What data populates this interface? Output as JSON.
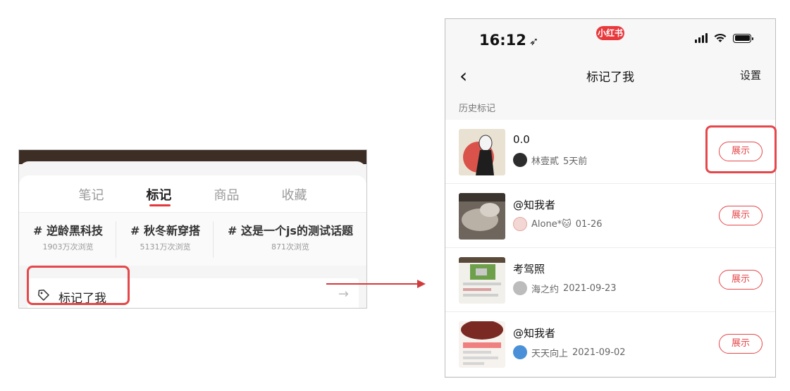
{
  "left": {
    "tabs": [
      "笔记",
      "标记",
      "商品",
      "收藏"
    ],
    "active_tab": "标记",
    "tags": [
      {
        "title": "# 逆龄黑科技",
        "views": "1903万次浏览"
      },
      {
        "title": "# 秋冬新穿搭",
        "views": "5131万次浏览"
      },
      {
        "title": "# 这是一个js的测试话题",
        "views": "871次浏览"
      }
    ],
    "marked_me_label": "标记了我",
    "arrow": "→"
  },
  "right": {
    "status": {
      "time": "16:12",
      "app_badge": "小红书"
    },
    "nav": {
      "back_glyph": "‹",
      "title": "标记了我",
      "settings": "设置"
    },
    "section_label": "历史标记",
    "items": [
      {
        "title": "0.0",
        "user": "林壹貳",
        "time": "5天前",
        "button": "展示"
      },
      {
        "title": "@知我者",
        "user": "Alone*🐱",
        "time": "01-26",
        "button": "展示"
      },
      {
        "title": "考驾照",
        "user": "海之约",
        "time": "2021-09-23",
        "button": "展示"
      },
      {
        "title": "@知我者",
        "user": "天天向上",
        "time": "2021-09-02",
        "button": "展示"
      }
    ]
  },
  "colors": {
    "accent": "#e5474a",
    "badge": "#e8393d"
  }
}
